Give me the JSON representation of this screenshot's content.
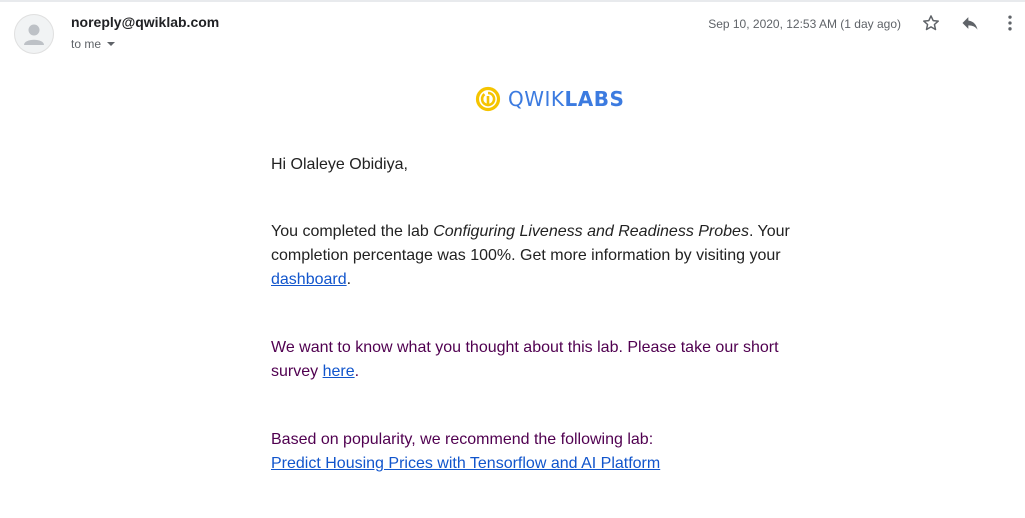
{
  "header": {
    "sender": "noreply@qwiklab.com",
    "recipient": "to me",
    "timestamp": "Sep 10, 2020, 12:53 AM (1 day ago)",
    "icons": [
      "avatar-icon",
      "star-icon",
      "reply-icon",
      "more-vert-icon"
    ]
  },
  "logo": {
    "text_light": "QWIK",
    "text_bold": "LABS",
    "colors": {
      "ring": "#f5c400",
      "text": "#3c7be0"
    }
  },
  "email": {
    "greeting": "Hi Olaleye Obidiya,",
    "p1_prefix": "You completed the lab ",
    "p1_lab": "Configuring Liveness and Readiness Probes",
    "p1_middle": ". Your completion percentage was 100%. Get more information by visiting your ",
    "p1_link": "dashboard",
    "p1_suffix": ".",
    "p2_prefix": "We want to know what you thought about this lab. Please take our short survey ",
    "p2_link": "here",
    "p2_suffix": ".",
    "p3_text": "Based on popularity, we recommend the following lab:",
    "p3_link": "Predict Housing Prices with Tensorflow and AI Platform"
  },
  "colors": {
    "body_text": "#222222",
    "quoted_text": "#500050",
    "link": "#1155cc"
  }
}
